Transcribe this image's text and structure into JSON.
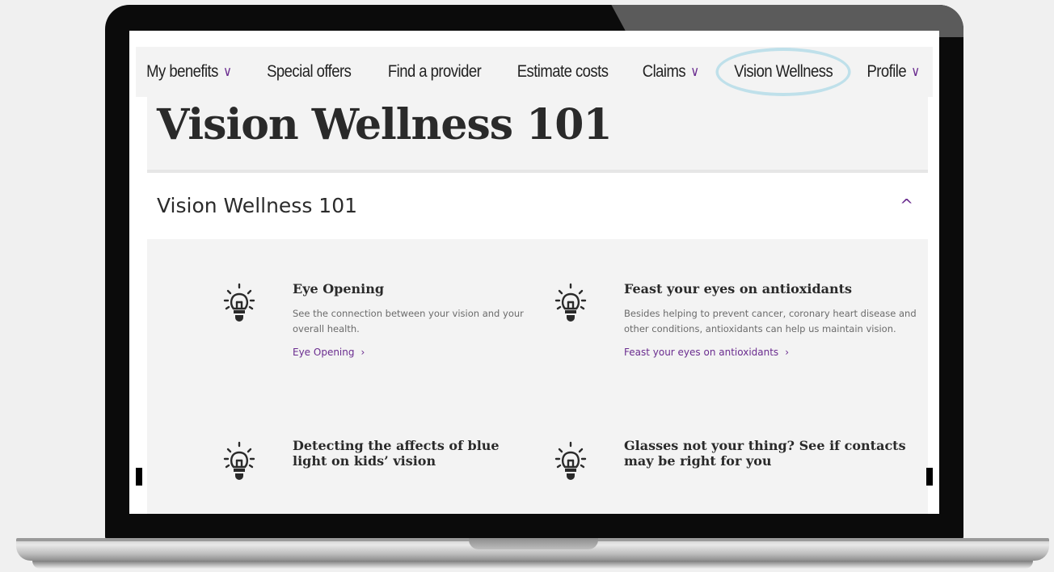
{
  "nav": {
    "items": [
      {
        "label": "My benefits",
        "chevron": "∨"
      },
      {
        "label": "Special offers",
        "chevron": ""
      },
      {
        "label": "Find a provider",
        "chevron": ""
      },
      {
        "label": "Estimate costs",
        "chevron": ""
      },
      {
        "label": "Claims",
        "chevron": "∨"
      },
      {
        "label": "Vision Wellness",
        "chevron": ""
      },
      {
        "label": "Profile",
        "chevron": "∨"
      }
    ]
  },
  "hero": {
    "title": "Vision Wellness 101"
  },
  "accordion": {
    "title": "Vision Wellness 101",
    "toggle_icon": "^"
  },
  "cards": [
    {
      "title": "Eye Opening",
      "description": "See the connection between your vision and your overall health.",
      "link": "Eye Opening",
      "link_arrow": "›",
      "icon": "lightbulb-icon"
    },
    {
      "title": "Feast your eyes on antioxidants",
      "description": "Besides helping to prevent cancer, coronary heart disease and other conditions, antioxidants can help us maintain vision.",
      "link": "Feast your eyes on antioxidants",
      "link_arrow": "›",
      "icon": "lightbulb-icon"
    },
    {
      "title": "Detecting the affects of blue light on kids’ vision",
      "description": "",
      "link": "",
      "icon": "lightbulb-icon"
    },
    {
      "title": "Glasses not your thing? See if contacts may be right for you",
      "description": "",
      "link": "",
      "icon": "lightbulb-icon"
    }
  ],
  "colors": {
    "accent": "#6a2c8f",
    "highlight_ring": "#bfe0ea",
    "panel_bg": "#f3f3f3"
  }
}
